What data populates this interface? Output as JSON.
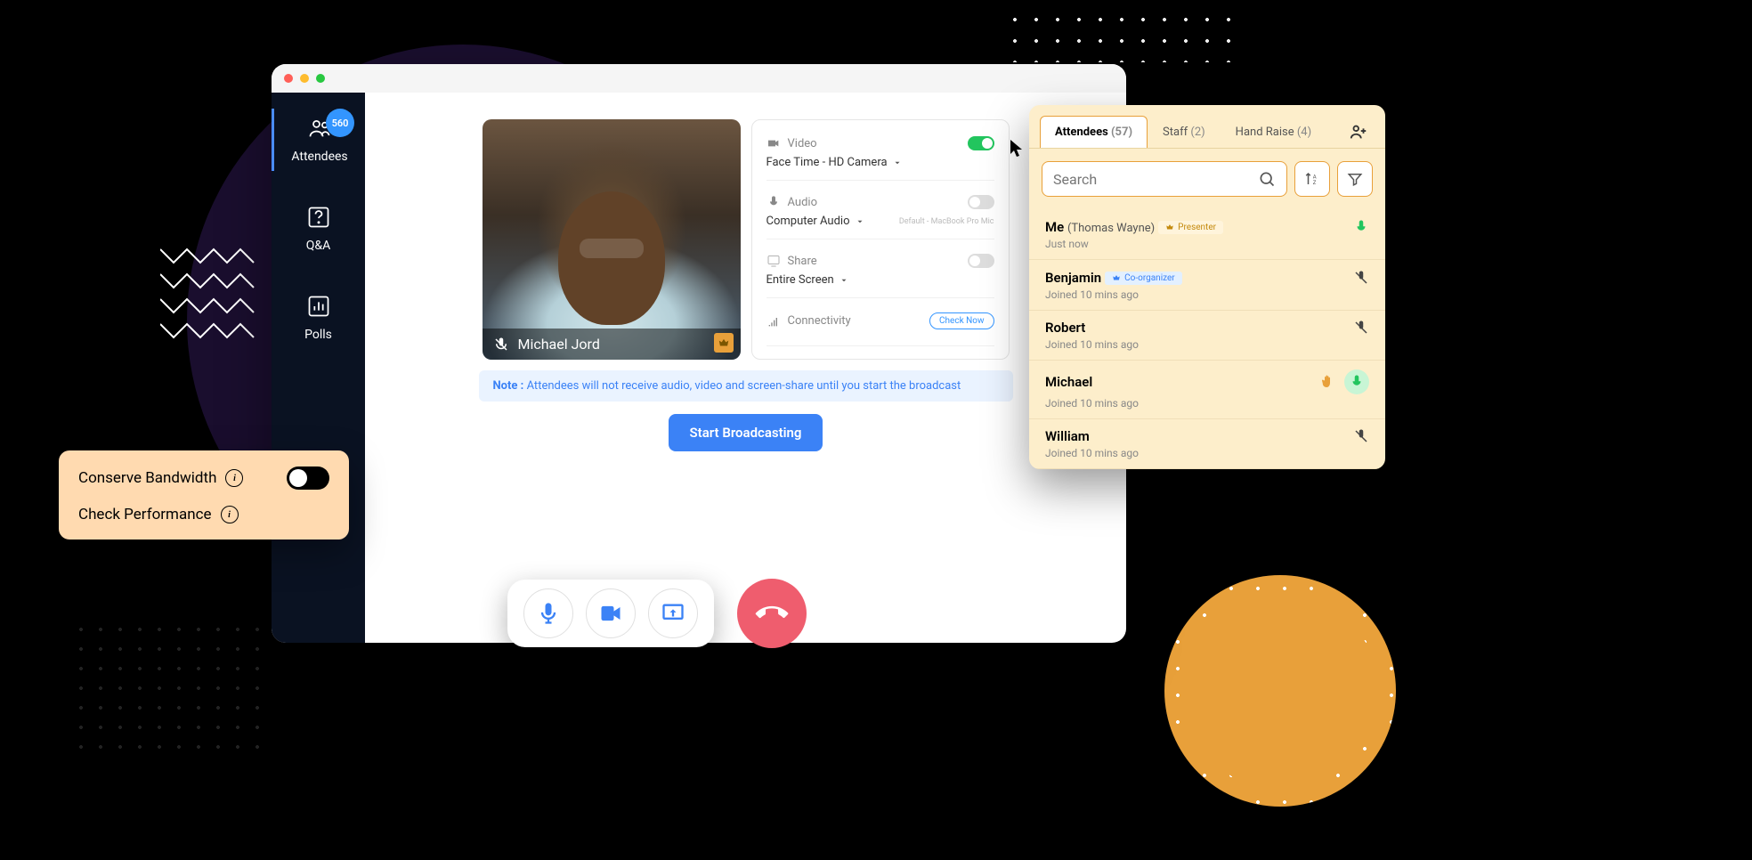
{
  "sidebar": {
    "attendees": {
      "label": "Attendees",
      "badge": "560"
    },
    "qa": {
      "label": "Q&A"
    },
    "polls": {
      "label": "Polls"
    }
  },
  "video_preview": {
    "name": "Michael Jord"
  },
  "settings": {
    "video": {
      "label": "Video",
      "value": "Face Time - HD Camera",
      "on": true
    },
    "audio": {
      "label": "Audio",
      "value": "Computer Audio",
      "default": "Default - MacBook Pro Mic",
      "on": false
    },
    "share": {
      "label": "Share",
      "value": "Entire Screen",
      "on": false
    },
    "connectivity": {
      "label": "Connectivity",
      "action": "Check Now"
    }
  },
  "note": {
    "prefix": "Note :",
    "text": "Attendees will not receive audio, video and screen-share until you start the broadcast"
  },
  "start_button": "Start Broadcasting",
  "bandwidth": {
    "conserve": "Conserve Bandwidth",
    "check": "Check Performance"
  },
  "attendees_panel": {
    "tabs": {
      "attendees": {
        "label": "Attendees",
        "count": "(57)"
      },
      "staff": {
        "label": "Staff",
        "count": "(2)"
      },
      "hand_raise": {
        "label": "Hand Raise",
        "count": "(4)"
      }
    },
    "search_placeholder": "Search",
    "items": [
      {
        "name": "Me",
        "sub": "(Thomas Wayne)",
        "role": "Presenter",
        "role_class": "presenter",
        "status": "Just now",
        "mic": "active"
      },
      {
        "name": "Benjamin",
        "role": "Co-organizer",
        "role_class": "coorganizer",
        "status": "Joined 10 mins ago",
        "mic": "muted"
      },
      {
        "name": "Robert",
        "status": "Joined 10 mins ago",
        "mic": "muted"
      },
      {
        "name": "Michael",
        "status": "Joined 10 mins ago",
        "mic": "active",
        "hand": true
      },
      {
        "name": "William",
        "status": "Joined 10 mins ago",
        "mic": "muted"
      }
    ]
  }
}
